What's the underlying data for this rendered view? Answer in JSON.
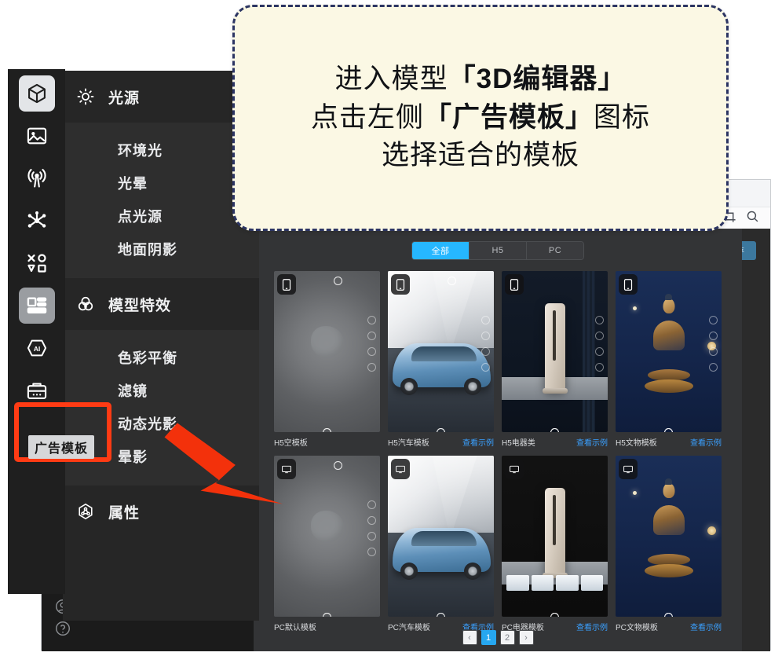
{
  "callout": {
    "line1_normal": "进入模型",
    "line1_bold": "「3D编辑器」",
    "line2_a": "点击左侧",
    "line2_bold": "「广告模板」",
    "line2_b": "图标",
    "line3": "选择适合的模板"
  },
  "sidebar": {
    "tooltip": "广告模板",
    "items": [
      {
        "name": "model-cube",
        "label": "模型",
        "state": "active"
      },
      {
        "name": "image",
        "label": "图片",
        "state": "normal"
      },
      {
        "name": "broadcast",
        "label": "广播",
        "state": "normal"
      },
      {
        "name": "node-network",
        "label": "节点",
        "state": "normal"
      },
      {
        "name": "shapes",
        "label": "图形",
        "state": "normal"
      },
      {
        "name": "ad-template",
        "label": "广告模板",
        "state": "selected"
      },
      {
        "name": "ai",
        "label": "AI",
        "state": "normal"
      },
      {
        "name": "toolbox",
        "label": "工具箱",
        "state": "normal"
      }
    ]
  },
  "menu": {
    "sections": [
      {
        "header": "光源",
        "header_icon": "sun-icon",
        "items": [
          "环境光",
          "光晕",
          "点光源",
          "地面阴影"
        ]
      },
      {
        "header": "模型特效",
        "header_icon": "circles-icon",
        "items": [
          "色彩平衡",
          "滤镜",
          "动态光影",
          "晕影"
        ]
      },
      {
        "header": "属性",
        "header_icon": "hexagon-node-icon",
        "items": []
      }
    ]
  },
  "editor": {
    "save_label": "保存",
    "toolbar_icons": [
      "crop-icon",
      "search-zoom-icon"
    ],
    "help_icon": "question-circle-icon"
  },
  "gallery": {
    "tabs": [
      {
        "label": "全部",
        "active": true
      },
      {
        "label": "H5",
        "active": false
      },
      {
        "label": "PC",
        "active": false
      }
    ],
    "cards": [
      {
        "title": "H5空模板",
        "link": "",
        "device": "phone",
        "art": "blank"
      },
      {
        "title": "H5汽车模板",
        "link": "查看示例",
        "device": "phone",
        "art": "car"
      },
      {
        "title": "H5电器类",
        "link": "查看示例",
        "device": "phone",
        "art": "ac"
      },
      {
        "title": "H5文物模板",
        "link": "查看示例",
        "device": "phone",
        "art": "buddha"
      },
      {
        "title": "PC默认模板",
        "link": "",
        "device": "monitor",
        "art": "blank"
      },
      {
        "title": "PC汽车模板",
        "link": "查看示例",
        "device": "monitor",
        "art": "car"
      },
      {
        "title": "PC电器模板",
        "link": "查看示例",
        "device": "monitor",
        "art": "acpc"
      },
      {
        "title": "PC文物模板",
        "link": "查看示例",
        "device": "monitor",
        "art": "buddha"
      }
    ],
    "pagination": {
      "prev": "‹",
      "next": "›",
      "pages": [
        {
          "label": "1",
          "active": true
        },
        {
          "label": "2",
          "active": false
        }
      ]
    }
  },
  "colors": {
    "accent_blue": "#26b7ff",
    "link_blue": "#3aa0ff",
    "highlight_red": "#ff3b14",
    "callout_bg": "#fbf8e4",
    "callout_border": "#2c3563",
    "panel_dark": "#262626"
  }
}
